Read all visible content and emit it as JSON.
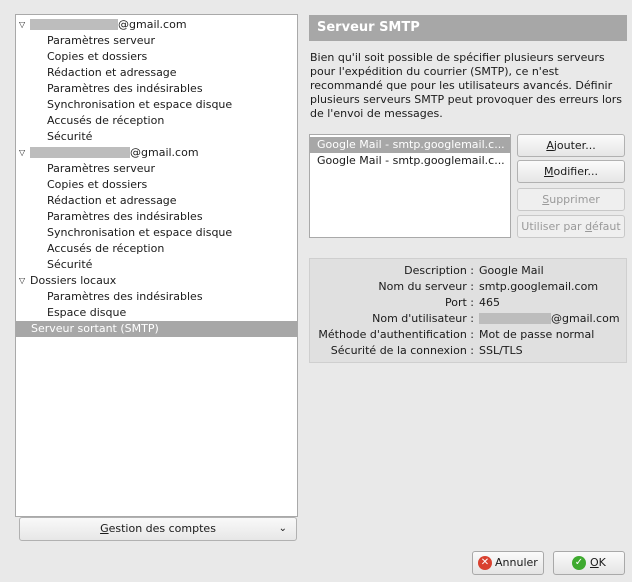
{
  "tree": {
    "accounts": [
      {
        "email_suffix": "@gmail.com",
        "children": [
          "Paramètres serveur",
          "Copies et dossiers",
          "Rédaction et adressage",
          "Paramètres des indésirables",
          "Synchronisation et espace disque",
          "Accusés de réception",
          "Sécurité"
        ]
      },
      {
        "email_suffix": "@gmail.com",
        "children": [
          "Paramètres serveur",
          "Copies et dossiers",
          "Rédaction et adressage",
          "Paramètres des indésirables",
          "Synchronisation et espace disque",
          "Accusés de réception",
          "Sécurité"
        ]
      }
    ],
    "local": {
      "label": "Dossiers locaux",
      "children": [
        "Paramètres des indésirables",
        "Espace disque"
      ]
    },
    "smtp_item": "Serveur sortant (SMTP)",
    "toggle_glyph": "▽"
  },
  "manage_accounts": {
    "mnemonic": "G",
    "rest": "estion des comptes",
    "chevron": "⌄"
  },
  "panel": {
    "title": "Serveur SMTP",
    "description": "Bien qu'il soit possible de spécifier plusieurs serveurs pour l'expédition du courrier (SMTP), ce n'est recommandé que pour les utilisateurs avancés. Définir plusieurs serveurs SMTP peut provoquer des erreurs lors de l'envoi de messages."
  },
  "servers": [
    "Google Mail - smtp.googlemail.c...",
    "Google Mail - smtp.googlemail.c..."
  ],
  "buttons": {
    "add": {
      "mnemonic": "A",
      "rest": "jouter..."
    },
    "edit": {
      "mnemonic": "M",
      "rest": "odifier..."
    },
    "delete": {
      "mnemonic": "S",
      "rest": "upprimer"
    },
    "default_pre": "Utiliser par ",
    "default_mnemonic": "d",
    "default_rest": "éfaut"
  },
  "details": {
    "labels": {
      "description": "Description :",
      "server_name": "Nom du serveur :",
      "port": "Port :",
      "username": "Nom d'utilisateur :",
      "auth_method": "Méthode d'authentification :",
      "security": "Sécurité de la connexion :"
    },
    "values": {
      "description": "Google Mail",
      "server_name": "smtp.googlemail.com",
      "port": "465",
      "username_suffix": "@gmail.com",
      "auth_method": "Mot de passe normal",
      "security": "SSL/TLS"
    }
  },
  "footer": {
    "cancel": "Annuler",
    "ok_mnemonic": "O",
    "ok_rest": "K",
    "cancel_color": "#d9412f",
    "ok_color": "#3eaa2f"
  }
}
